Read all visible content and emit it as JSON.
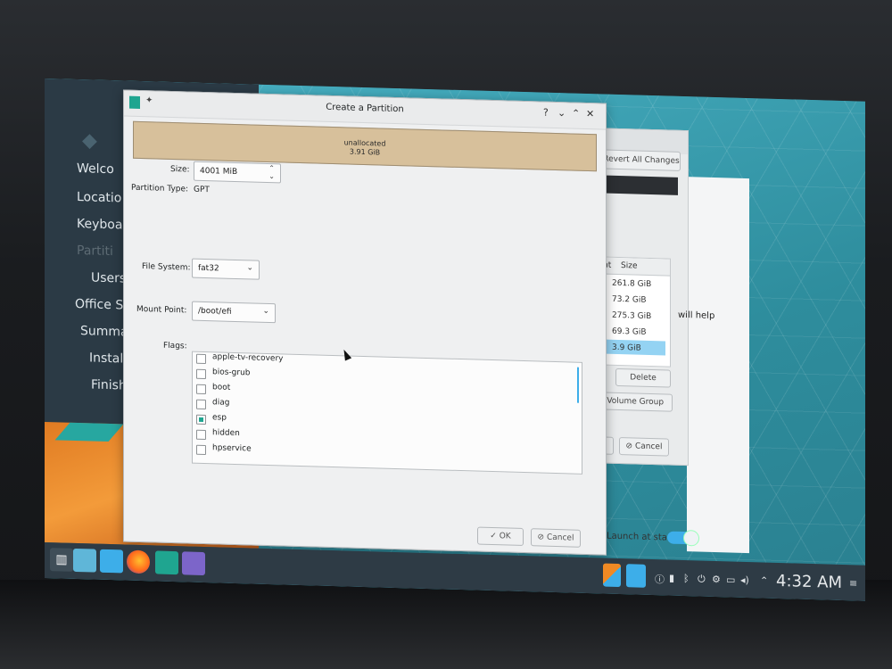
{
  "dialog": {
    "title": "Create a Partition",
    "unallocated_label": "unallocated",
    "unallocated_size": "3.91 GiB",
    "size_label": "Size:",
    "size_value": "4001 MiB",
    "partition_type_label": "Partition Type:",
    "partition_type_value": "GPT",
    "file_system_label": "File System:",
    "file_system_value": "fat32",
    "mount_point_label": "Mount Point:",
    "mount_point_value": "/boot/efi",
    "flags_label": "Flags:",
    "flags": [
      {
        "label": "apple-tv-recovery",
        "checked": false
      },
      {
        "label": "bios-grub",
        "checked": false
      },
      {
        "label": "boot",
        "checked": false
      },
      {
        "label": "diag",
        "checked": false
      },
      {
        "label": "esp",
        "checked": true
      },
      {
        "label": "hidden",
        "checked": false
      },
      {
        "label": "hpservice",
        "checked": false
      }
    ],
    "ok_label": "OK",
    "cancel_label": "Cancel"
  },
  "sidebar": {
    "items": [
      "Welco",
      "Locatio",
      "Keyboa",
      "Partiti",
      "Users",
      "Office Su",
      "Summa",
      "Instal",
      "Finish"
    ]
  },
  "background_window": {
    "revert_label": "Revert All Changes",
    "col_point": "oint",
    "col_size": "Size",
    "sizes": [
      "261.8 GiB",
      "73.2 GiB",
      "275.3 GiB",
      "69.3 GiB",
      "3.9 GiB"
    ],
    "delete_label": "Delete",
    "volume_group_label": "e Volume Group",
    "next_label": "xt",
    "cancel_label": "Cancel",
    "help_text": "will help",
    "launch_label": "Launch at start"
  },
  "taskbar": {
    "clock": "4:32 AM"
  },
  "colors": {
    "accent": "#1fa590",
    "highlight": "#3daee9",
    "unallocated": "#d7c09b"
  }
}
